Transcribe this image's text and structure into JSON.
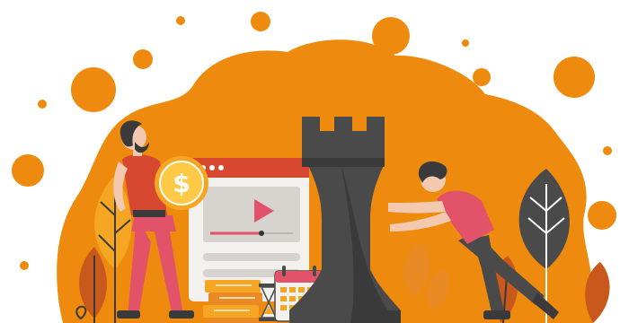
{
  "illustration": {
    "coin_symbol": "$"
  },
  "colors": {
    "orange": "#ee8a0e",
    "orange_light": "#f5a623",
    "dark_gray": "#4a4a4a",
    "pink": "#e25268",
    "cream": "#f3f1ee",
    "red": "#d8472f",
    "brown": "#c8581b",
    "white": "#ffffff"
  },
  "icons": [
    "chess-rook-icon",
    "dollar-coin-icon",
    "video-player-icon",
    "play-icon",
    "calendar-icon",
    "hourglass-icon",
    "stacked-books-icon",
    "leaf-plant-icon"
  ]
}
